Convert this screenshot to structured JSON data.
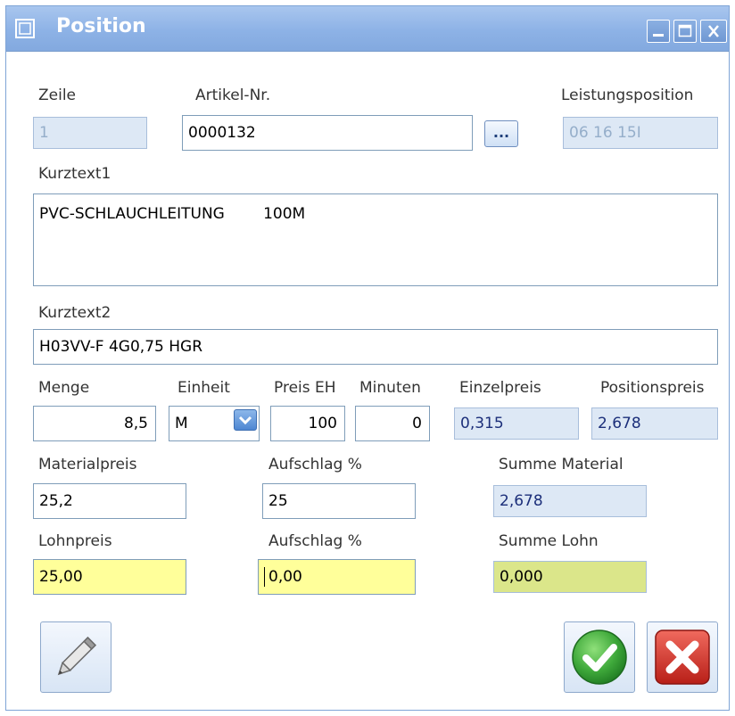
{
  "window": {
    "title": "Position",
    "icon": "window-icon",
    "controls": [
      "minimize-icon",
      "maximize-icon",
      "close-icon"
    ]
  },
  "fields": {
    "zeile": {
      "label": "Zeile",
      "value": "1"
    },
    "artikel_nr": {
      "label": "Artikel-Nr.",
      "value": "0000132",
      "browse_label": "..."
    },
    "leistungsposition": {
      "label": "Leistungsposition",
      "value": "06 16 15I"
    },
    "kurztext1": {
      "label": "Kurztext1",
      "value": "PVC-SCHLAUCHLEITUNG        100M"
    },
    "kurztext2": {
      "label": "Kurztext2",
      "value": "H03VV-F 4G0,75 HGR"
    },
    "menge": {
      "label": "Menge",
      "value": "8,5"
    },
    "einheit": {
      "label": "Einheit",
      "value": "M"
    },
    "preis_eh": {
      "label": "Preis EH",
      "value": "100"
    },
    "minuten": {
      "label": "Minuten",
      "value": "0"
    },
    "einzelpreis": {
      "label": "Einzelpreis",
      "value": "0,315"
    },
    "positionspreis": {
      "label": "Positionspreis",
      "value": "2,678"
    },
    "materialpreis": {
      "label": "Materialpreis",
      "value": "25,2"
    },
    "aufschlag_material": {
      "label": "Aufschlag %",
      "value": "25"
    },
    "summe_material": {
      "label": "Summe Material",
      "value": "2,678"
    },
    "lohnpreis": {
      "label": "Lohnpreis",
      "value": "25,00"
    },
    "aufschlag_lohn": {
      "label": "Aufschlag %",
      "value": "0,00"
    },
    "summe_lohn": {
      "label": "Summe Lohn",
      "value": "0,000"
    }
  },
  "buttons": {
    "edit": "pencil-icon",
    "ok": "checkmark-icon",
    "cancel": "x-icon"
  },
  "colors": {
    "titlebar": "#8db2e6",
    "readonly_bg": "#dde8f5",
    "highlight_yellow": "#ffff9a",
    "ok_green": "#3ea83a",
    "cancel_red": "#d4322b"
  }
}
